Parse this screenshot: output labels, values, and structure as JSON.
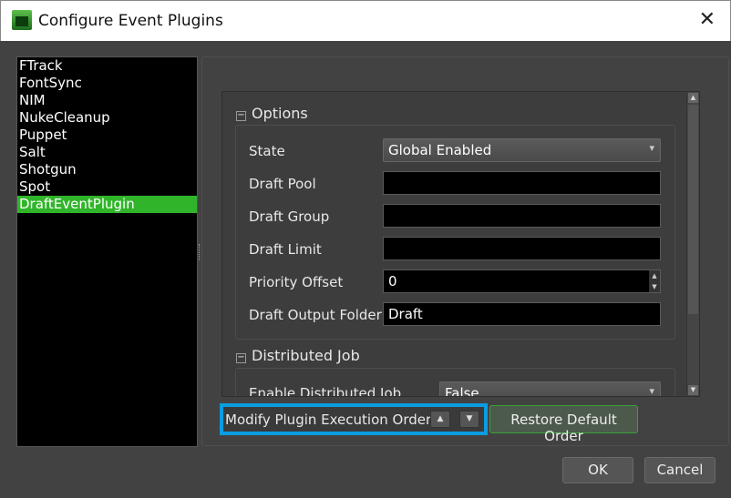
{
  "window": {
    "title": "Configure Event Plugins",
    "close_icon": "close-icon",
    "app_icon": "tv-icon"
  },
  "plugins": {
    "items": [
      "FTrack",
      "FontSync",
      "NIM",
      "NukeCleanup",
      "Puppet",
      "Salt",
      "Shotgun",
      "Spot",
      "DraftEventPlugin"
    ],
    "selected": "DraftEventPlugin",
    "selected_color": "#30b52a"
  },
  "options": {
    "title": "Options",
    "fields": [
      {
        "label": "State",
        "value": "Global Enabled",
        "type": "dropdown"
      },
      {
        "label": "Draft Pool",
        "value": "",
        "type": "text"
      },
      {
        "label": "Draft Group",
        "value": "",
        "type": "text"
      },
      {
        "label": "Draft Limit",
        "value": "",
        "type": "text"
      },
      {
        "label": "Priority Offset",
        "value": "0",
        "type": "spinbox"
      },
      {
        "label": "Draft Output Folder",
        "value": "Draft",
        "type": "text"
      }
    ]
  },
  "distributed": {
    "title": "Distributed Job",
    "fields": [
      {
        "label": "Enable Distributed Job",
        "value": "False",
        "type": "dropdown"
      }
    ]
  },
  "order": {
    "label": "Modify Plugin Execution Order",
    "highlight_color": "#0a9de0",
    "restore_label": "Restore Default Order"
  },
  "buttons": {
    "ok": "OK",
    "cancel": "Cancel"
  }
}
